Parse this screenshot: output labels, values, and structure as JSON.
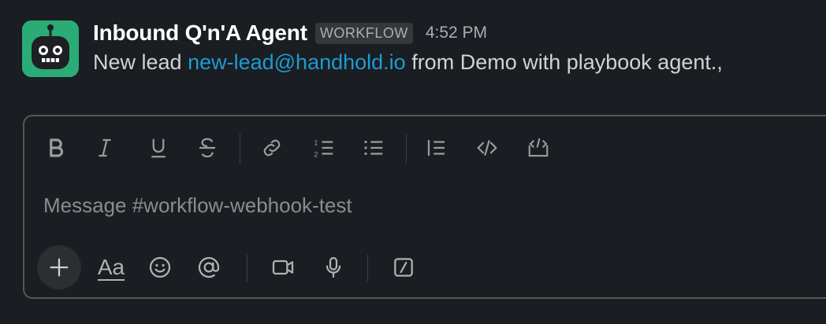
{
  "message": {
    "sender": "Inbound Q'n'A Agent",
    "badge": "WORKFLOW",
    "time": "4:52 PM",
    "text_before": "New lead ",
    "link": "new-lead@handhold.io",
    "text_after": " from Demo with playbook agent.,"
  },
  "composer": {
    "placeholder": "Message #workflow-webhook-test",
    "format_label": "Aa"
  },
  "colors": {
    "background": "#1a1d21",
    "avatar": "#2bac76",
    "link": "#1d9bd1",
    "border": "#565856"
  },
  "icons": [
    "bold-icon",
    "italic-icon",
    "underline-icon",
    "strikethrough-icon",
    "link-icon",
    "ordered-list-icon",
    "bulleted-list-icon",
    "blockquote-icon",
    "code-icon",
    "code-block-icon",
    "plus-icon",
    "emoji-icon",
    "mention-icon",
    "video-icon",
    "microphone-icon",
    "slash-command-icon"
  ]
}
